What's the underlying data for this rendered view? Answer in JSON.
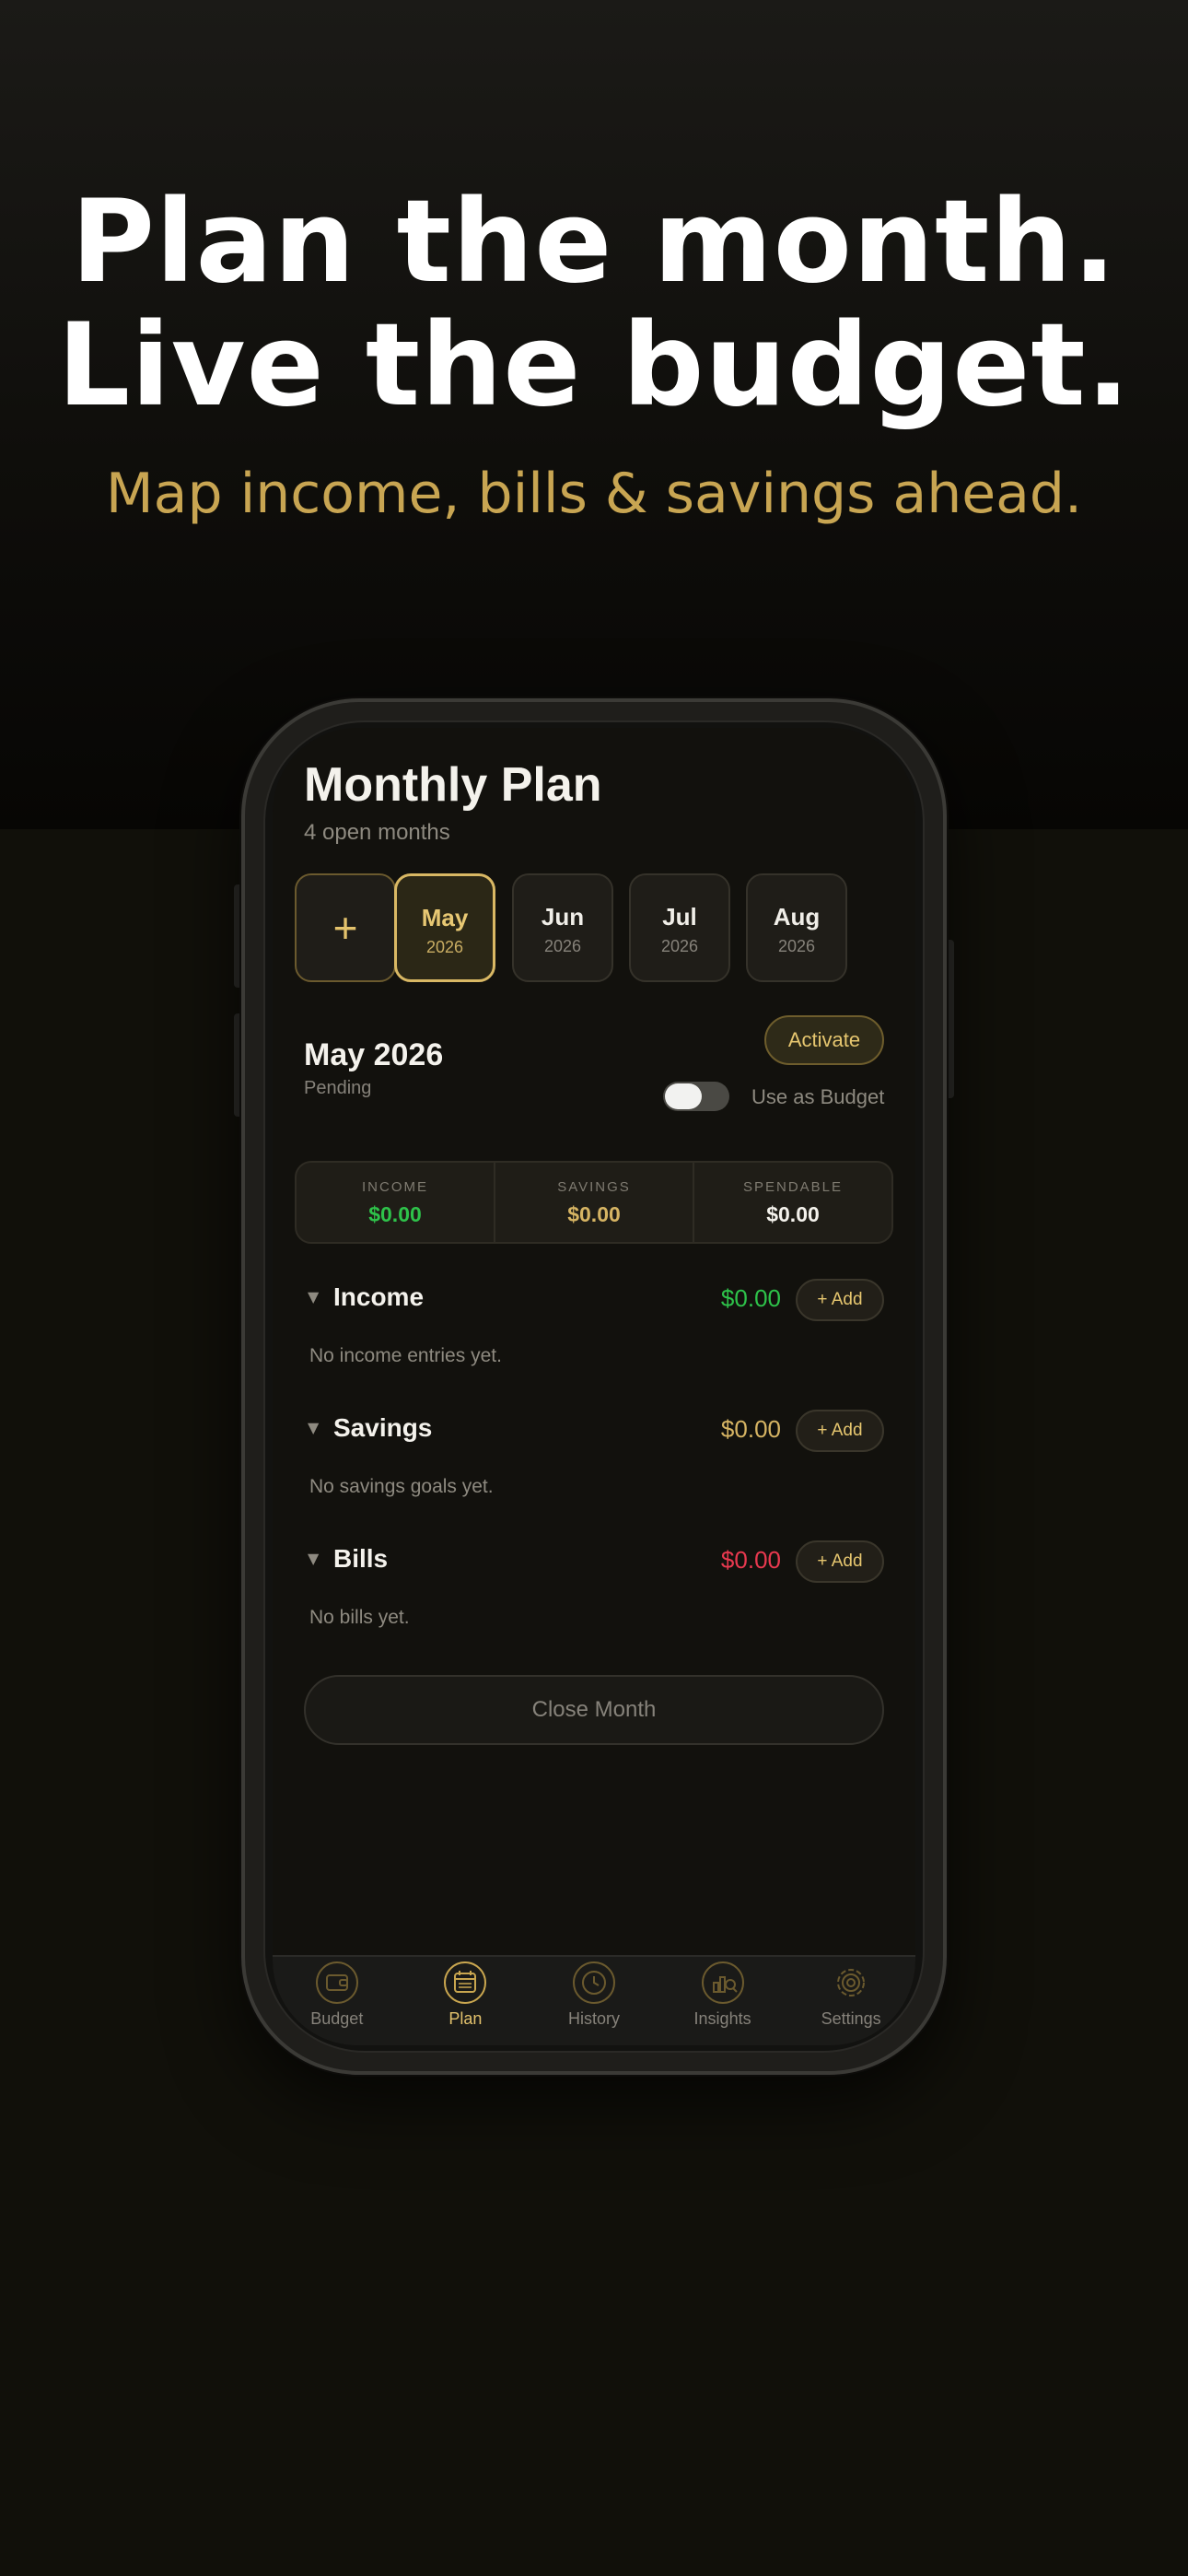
{
  "hero": {
    "headline_line1": "Plan the month.",
    "headline_line2": "Live the budget.",
    "subheadline": "Map income, bills & savings ahead."
  },
  "screen": {
    "title": "Monthly Plan",
    "subtitle": "4 open months",
    "add_month_label": "+",
    "months": [
      {
        "name": "May",
        "year": "2026",
        "selected": true
      },
      {
        "name": "Jun",
        "year": "2026",
        "selected": false
      },
      {
        "name": "Jul",
        "year": "2026",
        "selected": false
      },
      {
        "name": "Aug",
        "year": "2026",
        "selected": false
      }
    ],
    "selected_month": {
      "title": "May 2026",
      "status": "Pending",
      "activate_label": "Activate",
      "use_as_budget_label": "Use as Budget",
      "use_as_budget_on": false
    },
    "summary": {
      "income_label": "INCOME",
      "income_value": "$0.00",
      "savings_label": "SAVINGS",
      "savings_value": "$0.00",
      "spendable_label": "SPENDABLE",
      "spendable_value": "$0.00"
    },
    "sections": {
      "income": {
        "caret": "▼",
        "name": "Income",
        "amount": "$0.00",
        "add_label": "+ Add",
        "empty": "No income entries yet."
      },
      "savings": {
        "caret": "▼",
        "name": "Savings",
        "amount": "$0.00",
        "add_label": "+ Add",
        "empty": "No savings goals yet."
      },
      "bills": {
        "caret": "▼",
        "name": "Bills",
        "amount": "$0.00",
        "add_label": "+ Add",
        "empty": "No bills yet."
      }
    },
    "close_month_label": "Close Month",
    "tabs": [
      {
        "label": "Budget",
        "icon": "wallet-icon",
        "active": false
      },
      {
        "label": "Plan",
        "icon": "calendar-icon",
        "active": true
      },
      {
        "label": "History",
        "icon": "clock-icon",
        "active": false
      },
      {
        "label": "Insights",
        "icon": "chart-icon",
        "active": false
      },
      {
        "label": "Settings",
        "icon": "gear-icon",
        "active": false
      }
    ]
  },
  "colors": {
    "accent_gold": "#e3c26c",
    "income_green": "#2ec24a",
    "savings_gold": "#d6b463",
    "bills_red": "#e8394f",
    "background": "#11100a"
  }
}
